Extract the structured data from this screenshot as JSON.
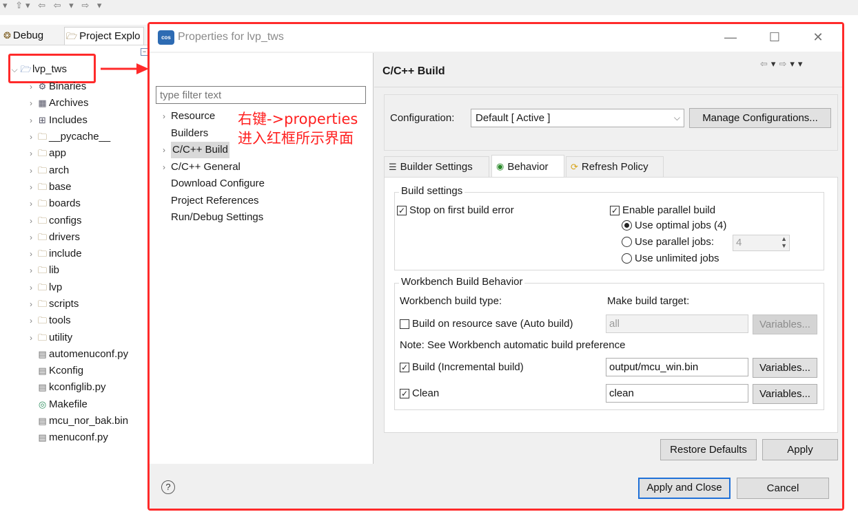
{
  "toolbar": {
    "glyphs": "▾ ⇧▾ ⇦ ⇦ ▾ ⇨ ▾"
  },
  "explorer": {
    "tabs": [
      {
        "icon": "❂",
        "label": "Debug"
      },
      {
        "icon": "🗁",
        "label": "Project Explo"
      }
    ],
    "root": {
      "label": "lvp_tws"
    },
    "items": [
      {
        "label": "Binaries",
        "kind": "special",
        "icon": "⚙"
      },
      {
        "label": "Archives",
        "kind": "special",
        "icon": "▦"
      },
      {
        "label": "Includes",
        "kind": "special",
        "icon": "⊞"
      },
      {
        "label": "__pycache__",
        "kind": "folder"
      },
      {
        "label": "app",
        "kind": "folder"
      },
      {
        "label": "arch",
        "kind": "folder"
      },
      {
        "label": "base",
        "kind": "folder"
      },
      {
        "label": "boards",
        "kind": "folder"
      },
      {
        "label": "configs",
        "kind": "folder"
      },
      {
        "label": "drivers",
        "kind": "folder"
      },
      {
        "label": "include",
        "kind": "folder"
      },
      {
        "label": "lib",
        "kind": "folder"
      },
      {
        "label": "lvp",
        "kind": "folder"
      },
      {
        "label": "scripts",
        "kind": "folder"
      },
      {
        "label": "tools",
        "kind": "folder"
      },
      {
        "label": "utility",
        "kind": "folder"
      },
      {
        "label": "automenuconf.py",
        "kind": "file"
      },
      {
        "label": "Kconfig",
        "kind": "file"
      },
      {
        "label": "kconfiglib.py",
        "kind": "file"
      },
      {
        "label": "Makefile",
        "kind": "makefile"
      },
      {
        "label": "mcu_nor_bak.bin",
        "kind": "file"
      },
      {
        "label": "menuconf.py",
        "kind": "file"
      }
    ]
  },
  "dialog": {
    "logo_text": "cos",
    "title": "Properties for lvp_tws",
    "filter_placeholder": "type filter text",
    "nav": [
      {
        "label": "Resource",
        "expandable": true,
        "selected": false
      },
      {
        "label": "Builders",
        "expandable": false,
        "selected": false
      },
      {
        "label": "C/C++ Build",
        "expandable": true,
        "selected": true
      },
      {
        "label": "C/C++ General",
        "expandable": true,
        "selected": false
      },
      {
        "label": "Download Configure",
        "expandable": false,
        "selected": false
      },
      {
        "label": "Project References",
        "expandable": false,
        "selected": false
      },
      {
        "label": "Run/Debug Settings",
        "expandable": false,
        "selected": false
      }
    ],
    "annotation": {
      "line1": "右键->properties",
      "line2": "进入红框所示界面"
    },
    "page_title": "C/C++ Build",
    "configuration": {
      "label": "Configuration:",
      "value": "Default  [ Active ]",
      "manage_label": "Manage Configurations..."
    },
    "tabs": [
      {
        "label": "Builder Settings",
        "icon": "☰"
      },
      {
        "label": "Behavior",
        "icon": "◉"
      },
      {
        "label": "Refresh Policy",
        "icon": "⟳"
      }
    ],
    "build_settings": {
      "title": "Build settings",
      "stop_on_error": {
        "label": "Stop on first build error",
        "checked": true
      },
      "parallel": {
        "label": "Enable parallel build",
        "checked": true
      },
      "optimal": {
        "label": "Use optimal jobs (4)",
        "selected": true
      },
      "parallel_jobs": {
        "label": "Use parallel jobs:",
        "value": "4",
        "selected": false
      },
      "unlimited": {
        "label": "Use unlimited jobs",
        "selected": false
      }
    },
    "workbench": {
      "title": "Workbench Build Behavior",
      "type_label": "Workbench build type:",
      "target_label": "Make build target:",
      "auto_build": {
        "label": "Build on resource save (Auto build)",
        "checked": false,
        "target": "all"
      },
      "note": "Note: See Workbench automatic build preference",
      "incremental": {
        "label": "Build (Incremental build)",
        "checked": true,
        "target": "output/mcu_win.bin"
      },
      "clean": {
        "label": "Clean",
        "checked": true,
        "target": "clean"
      },
      "variables_label": "Variables..."
    },
    "restore_defaults": "Restore Defaults",
    "apply": "Apply",
    "apply_close": "Apply and Close",
    "cancel": "Cancel",
    "help": "?"
  },
  "colors": {
    "highlight": "#ff2a2a",
    "primary_border": "#1e70d8"
  }
}
